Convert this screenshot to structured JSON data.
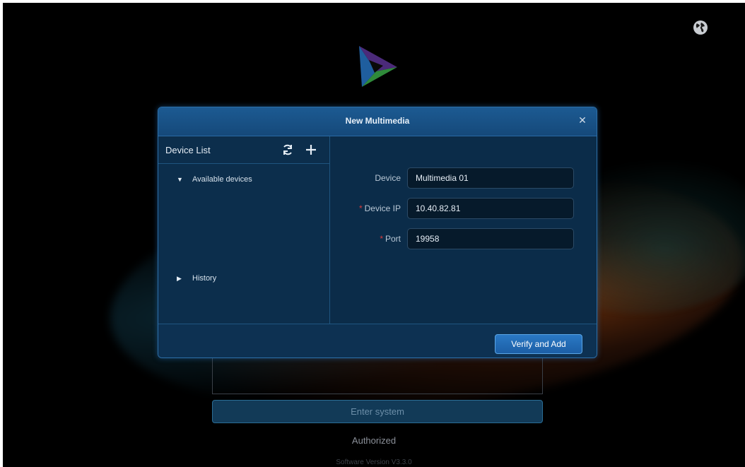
{
  "dialog": {
    "title": "New Multimedia",
    "close_icon": "close-icon",
    "device_list": {
      "title": "Device List",
      "icons": [
        "refresh-icon",
        "add-icon"
      ],
      "groups": [
        {
          "label": "Available devices",
          "expanded": true
        },
        {
          "label": "History",
          "expanded": false
        }
      ]
    },
    "form": {
      "device": {
        "label": "Device",
        "required": false,
        "value": "Multimedia 01"
      },
      "device_ip": {
        "label": "Device IP",
        "required": true,
        "value": "10.40.82.81"
      },
      "port": {
        "label": "Port",
        "required": true,
        "value": "19958"
      },
      "required_marker": "*"
    },
    "verify_button": "Verify and Add"
  },
  "background": {
    "enter_button": "Enter system",
    "authorized": "Authorized",
    "version": "Software Version V3.3.0",
    "icons": [
      "globe-icon",
      "app-logo"
    ]
  },
  "colors": {
    "dialog_bg": "#0b2c49",
    "accent": "#2a78c4",
    "required": "#d93a3a"
  }
}
